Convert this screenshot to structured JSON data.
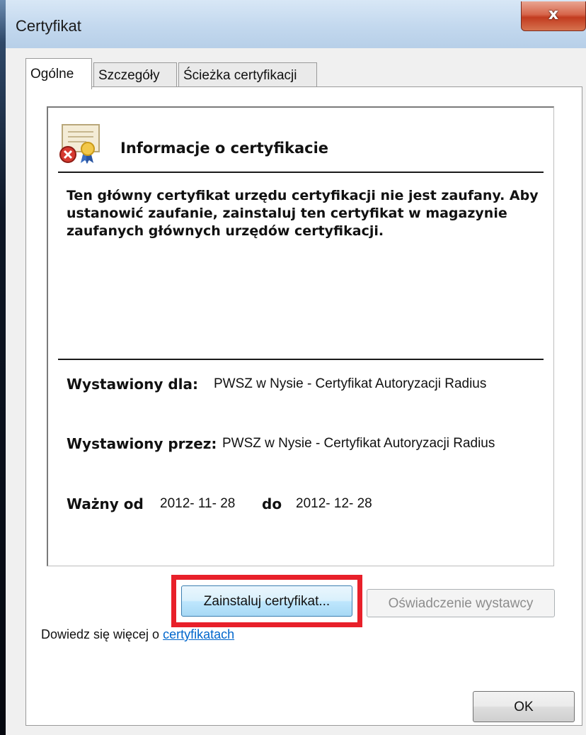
{
  "window": {
    "title": "Certyfikat",
    "close_symbol": "x"
  },
  "tabs": [
    {
      "label": "Ogólne",
      "active": true
    },
    {
      "label": "Szczegóły",
      "active": false
    },
    {
      "label": "Ścieżka certyfikacji",
      "active": false
    }
  ],
  "info": {
    "icon": "certificate-error-icon",
    "title": "Informacje o certyfikacie",
    "warning": "Ten główny certyfikat urzędu certyfikacji nie jest zaufany. Aby ustanowić zaufanie, zainstaluj ten certyfikat w magazynie zaufanych głównych urzędów certyfikacji.",
    "issued_to_label": "Wystawiony dla:",
    "issued_to": "PWSZ w Nysie - Certyfikat Autoryzacji Radius",
    "issued_by_label": "Wystawiony przez:",
    "issued_by": "PWSZ w Nysie - Certyfikat Autoryzacji Radius",
    "valid_from_label": "Ważny od",
    "valid_from": "2012- 11- 28",
    "valid_to_label": "do",
    "valid_to": "2012- 12- 28"
  },
  "buttons": {
    "install": "Zainstaluj certyfikat...",
    "issuer_statement": "Oświadczenie wystawcy",
    "ok": "OK"
  },
  "learn_more": {
    "text": "Dowiedz się więcej o ",
    "link": "certyfikatach"
  },
  "colors": {
    "highlight": "#e8202a",
    "link": "#0066cc"
  }
}
